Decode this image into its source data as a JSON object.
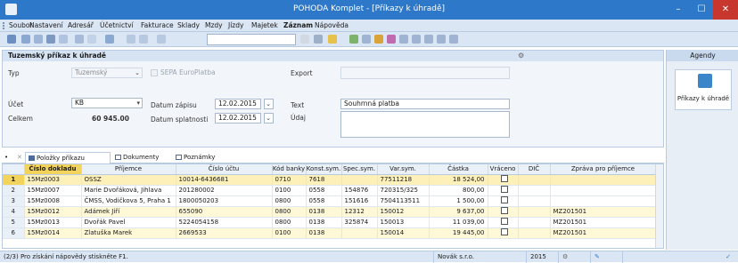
{
  "window": {
    "title": "POHODA Komplet - [Příkazy k úhradě]",
    "minimize": "–",
    "maximize": "☐",
    "close": "✕"
  },
  "menu": [
    "Soubor",
    "Nastavení",
    "Adresář",
    "Účetnictví",
    "Fakturace",
    "Sklady",
    "Mzdy",
    "Jízdy",
    "Majetek",
    "Záznam",
    "Nápověda"
  ],
  "form": {
    "header": "Tuzemský příkaz k úhradě",
    "typ_label": "Typ",
    "typ_value": "Tuzemský",
    "sepa_label": "SEPA EuroPlatba",
    "export_label": "Export",
    "ucet_label": "Účet",
    "ucet_value": "KB",
    "celkem_label": "Celkem",
    "celkem_value": "60 945.00",
    "datum_zapisu_label": "Datum zápisu",
    "datum_zapisu_value": "12.02.2015",
    "datum_splatnosti_label": "Datum splatnosti",
    "datum_splatnosti_value": "12.02.2015",
    "text_label": "Text",
    "text_value": "Souhrnná platba",
    "udaj_label": "Údaj"
  },
  "sidebar": {
    "header": "Agendy",
    "tile_label": "Příkazy k úhradě"
  },
  "tabs": [
    "Položky příkazu",
    "Dokumenty",
    "Poznámky"
  ],
  "grid": {
    "columns": [
      "",
      "Číslo dokladu",
      "Příjemce",
      "Číslo účtu",
      "Kód banky",
      "Konst.sym.",
      "Spec.sym.",
      "Var.sym.",
      "Částka",
      "Vráceno",
      "DIČ",
      "Zpráva pro příjemce"
    ],
    "rows": [
      [
        "1",
        "15Mz0003",
        "OSSZ",
        "10014-6436681",
        "0710",
        "7618",
        "",
        "77511218",
        "18 524,00",
        "",
        "",
        ""
      ],
      [
        "2",
        "15Mz0007",
        "Marie Dvořáková, Jihlava",
        "201280002",
        "0100",
        "0558",
        "154876",
        "720315/325",
        "800,00",
        "",
        "",
        ""
      ],
      [
        "3",
        "15Mz0008",
        "ČMSS, Vodičkova 5, Praha 1",
        "1800050203",
        "0800",
        "0558",
        "151616",
        "7504113511",
        "1 500,00",
        "",
        "",
        ""
      ],
      [
        "4",
        "15Mz0012",
        "Adámek Jiří",
        "655090",
        "0800",
        "0138",
        "12312",
        "150012",
        "9 637,00",
        "",
        "",
        "MZ201501"
      ],
      [
        "5",
        "15Mz0013",
        "Dvořák Pavel",
        "5224054158",
        "0800",
        "0138",
        "325874",
        "150013",
        "11 039,00",
        "",
        "",
        "MZ201501"
      ],
      [
        "6",
        "15Mz0014",
        "Zlatuška Marek",
        "2669533",
        "0100",
        "0138",
        "",
        "150014",
        "19 445,00",
        "",
        "",
        "MZ201501"
      ]
    ]
  },
  "status": {
    "help": "(2/3) Pro získání nápovědy stiskněte F1.",
    "company": "Novák s.r.o.",
    "year": "2015"
  }
}
